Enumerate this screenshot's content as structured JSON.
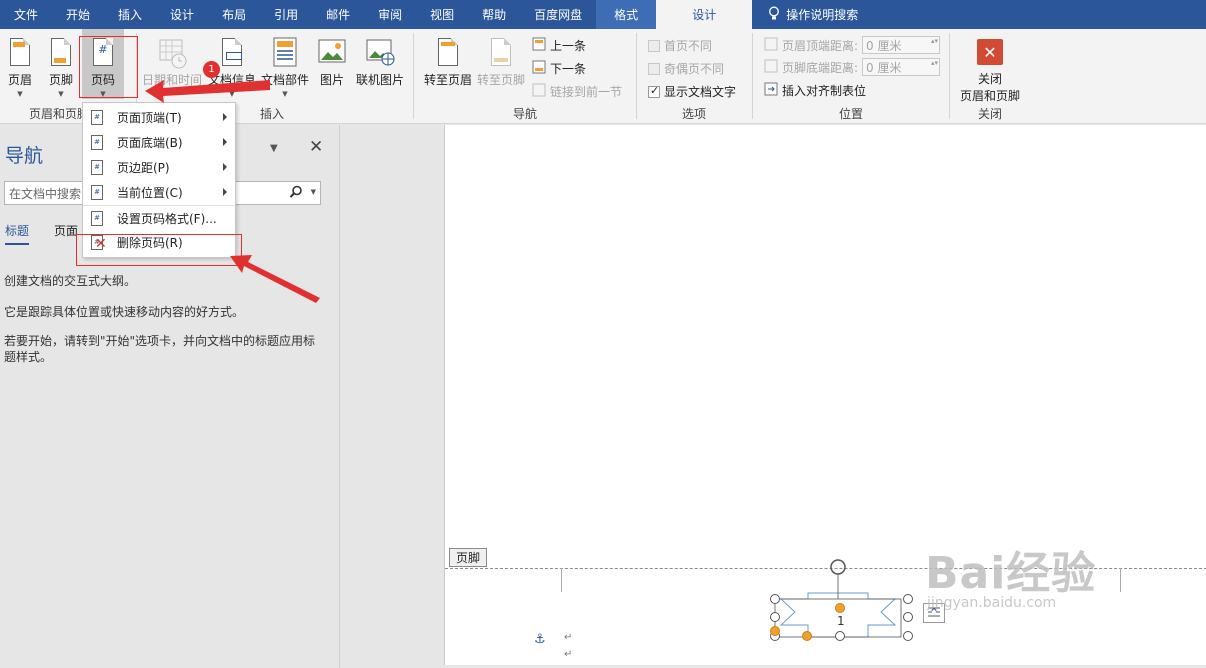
{
  "tabs": [
    "文件",
    "开始",
    "插入",
    "设计",
    "布局",
    "引用",
    "邮件",
    "审阅",
    "视图",
    "帮助",
    "百度网盘"
  ],
  "context_tab": "格式",
  "active_tab": "设计",
  "tell_me": "操作说明搜索",
  "ribbon": {
    "header_footer": {
      "header": "页眉",
      "footer": "页脚",
      "page_number": "页码",
      "group": "页眉和页脚"
    },
    "insert": {
      "date_time": "日期和时间",
      "doc_info": "文档信息",
      "doc_parts": "文档部件",
      "picture": "图片",
      "online_picture": "联机图片",
      "group": "插入"
    },
    "navigation": {
      "goto_header": "转至页眉",
      "goto_footer": "转至页脚",
      "previous": "上一条",
      "next": "下一条",
      "link_previous": "链接到前一节",
      "group": "导航"
    },
    "options": {
      "diff_first": "首页不同",
      "diff_odd_even": "奇偶页不同",
      "show_doc_text": "显示文档文字",
      "group": "选项"
    },
    "position": {
      "header_top": "页眉顶端距离:",
      "footer_bottom": "页脚底端距离:",
      "header_value": "0 厘米",
      "footer_value": "0 厘米",
      "insert_align_tab": "插入对齐制表位",
      "group": "位置"
    },
    "close": {
      "line1": "关闭",
      "line2": "页眉和页脚",
      "group": "关闭"
    }
  },
  "menu": {
    "items": [
      {
        "label": "页面顶端(T)",
        "submenu": true
      },
      {
        "label": "页面底端(B)",
        "submenu": true
      },
      {
        "label": "页边距(P)",
        "submenu": true
      },
      {
        "label": "当前位置(C)",
        "submenu": true
      },
      {
        "label": "设置页码格式(F)...",
        "submenu": false
      },
      {
        "label": "删除页码(R)",
        "submenu": false
      }
    ]
  },
  "badge": "1",
  "nav": {
    "title": "导航",
    "search_placeholder": "在文档中搜索",
    "tabs": [
      "标题",
      "页面"
    ],
    "text1": "创建文档的交互式大纲。",
    "text2": "它是跟踪具体位置或快速移动内容的好方式。",
    "text3": "若要开始，请转到\"开始\"选项卡，并向文档中的标题应用标题样式。"
  },
  "document": {
    "footer_label": "页脚",
    "page_number": "1"
  },
  "watermark": {
    "brand": "Bai经验",
    "url": "jingyan.baidu.com"
  },
  "colors": {
    "accent": "#2b579a",
    "annotation_red": "#e03030",
    "handle_orange": "#f0a030"
  }
}
